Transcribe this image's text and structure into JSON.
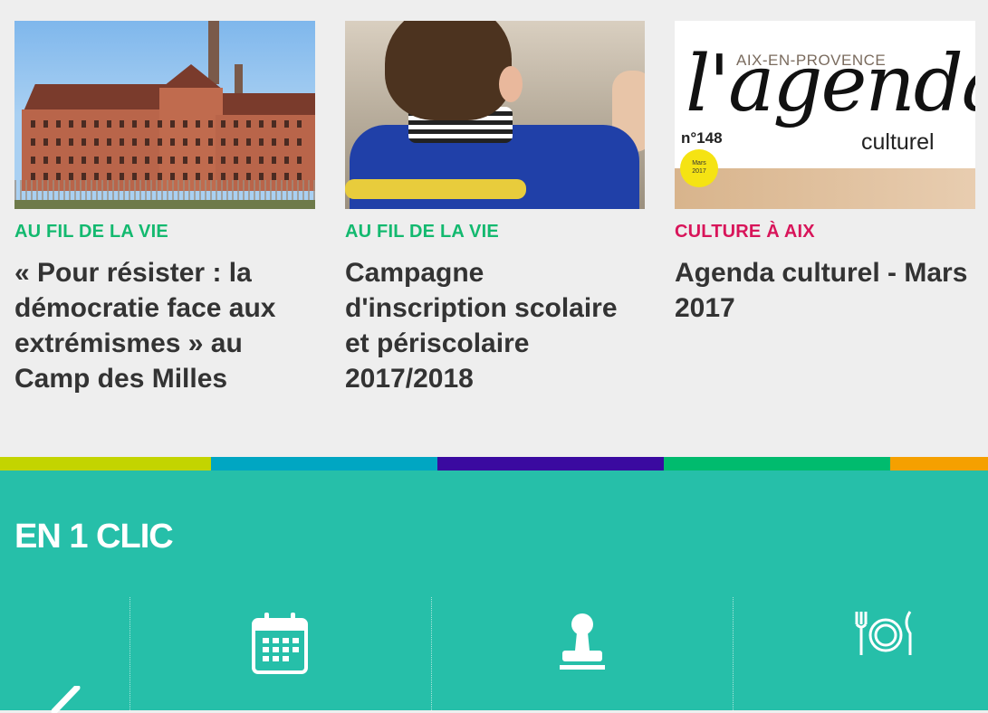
{
  "articles": [
    {
      "category": "AU FIL DE LA VIE",
      "title": "« Pour résister : la démocratie face aux extrémismes » au Camp des Milles",
      "color": "#13b96f"
    },
    {
      "category": "AU FIL DE LA VIE",
      "title": "Campagne d'inscription scolaire et périscolaire 2017/2018",
      "color": "#13b96f"
    },
    {
      "category": "CULTURE À AIX",
      "title": "Agenda culturel - Mars 2017",
      "color": "#d8155a"
    }
  ],
  "agenda_cover": {
    "city": "AIX-EN-PROVENCE",
    "word": "l'agenda",
    "subtitle": "culturel",
    "issue": "n°148",
    "badge_month": "Mars",
    "badge_year": "2017"
  },
  "colorbar": [
    "#c3d400",
    "#00a6c2",
    "#3a0aa0",
    "#00bb6e",
    "#f5a000"
  ],
  "en_un_clic": {
    "heading": "EN 1 CLIC",
    "icons": [
      "calendar-icon",
      "stamp-icon",
      "restaurant-icon"
    ]
  }
}
